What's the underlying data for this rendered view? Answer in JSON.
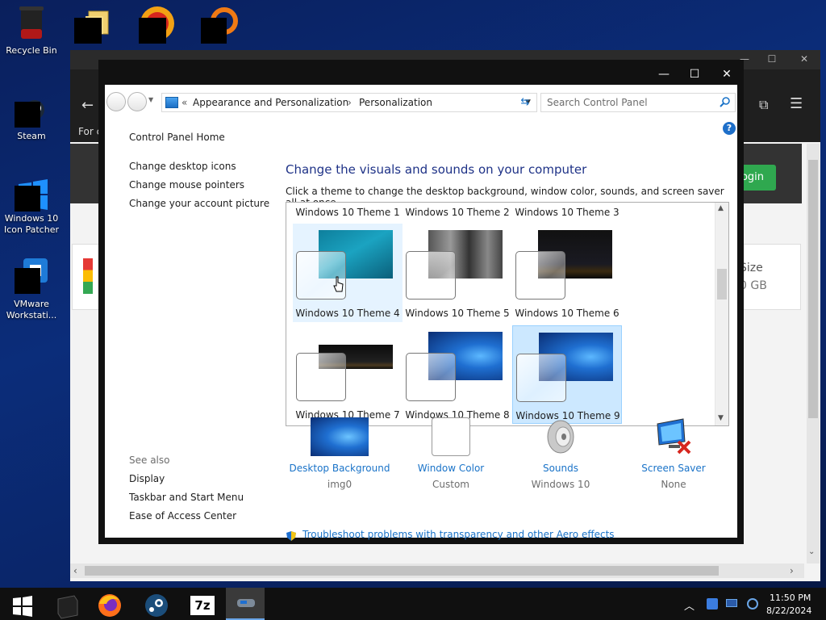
{
  "desktop": {
    "icons": [
      {
        "label": "Recycle Bin"
      },
      {
        "label": "Steam"
      },
      {
        "label": "Windows 10 Icon Patcher"
      },
      {
        "label": "VMware Workstati..."
      }
    ]
  },
  "background_window": {
    "partial_text_1": "For c",
    "login_button": "ogin",
    "size_label": "Size",
    "size_value": "0 GB"
  },
  "control_panel": {
    "address": {
      "prefix": "«",
      "crumbs": [
        "Appearance and Personalization",
        "Personalization"
      ],
      "separator": "›"
    },
    "search_placeholder": "Search Control Panel",
    "sidebar": {
      "home": "Control Panel Home",
      "links": [
        "Change desktop icons",
        "Change mouse pointers",
        "Change your account picture"
      ],
      "see_also_title": "See also",
      "see_also": [
        "Display",
        "Taskbar and Start Menu",
        "Ease of Access Center"
      ]
    },
    "title": "Change the visuals and sounds on your computer",
    "subtitle": "Click a theme to change the desktop background, window color, sounds, and screen saver all at once.",
    "themes": [
      {
        "label": "Windows 10 Theme 1"
      },
      {
        "label": "Windows 10 Theme 2"
      },
      {
        "label": "Windows 10 Theme 3"
      },
      {
        "label": "Windows 10 Theme 4"
      },
      {
        "label": "Windows 10 Theme 5"
      },
      {
        "label": "Windows 10 Theme 6"
      },
      {
        "label": "Windows 10 Theme 7"
      },
      {
        "label": "Windows 10 Theme 8"
      },
      {
        "label": "Windows 10 Theme 9"
      }
    ],
    "selected_theme": "Windows 10 Theme 9",
    "hovered_theme": "Windows 10 Theme 4",
    "bottom": [
      {
        "link": "Desktop Background",
        "value": "img0"
      },
      {
        "link": "Window Color",
        "value": "Custom"
      },
      {
        "link": "Sounds",
        "value": "Windows 10"
      },
      {
        "link": "Screen Saver",
        "value": "None"
      }
    ],
    "troubleshoot": "Troubleshoot problems with transparency and other Aero effects"
  },
  "taskbar": {
    "time": "11:50 PM",
    "date": "8/22/2024",
    "apps": [
      "start-icon",
      "terminal-icon",
      "firefox-icon",
      "steam-icon",
      "7zip-icon",
      "vmware-icon"
    ],
    "seven_zip_label": "7z"
  },
  "colors": {
    "accent_link": "#1a73c8",
    "title_blue": "#1e3287",
    "selected_tile": "#cce8ff",
    "login_green": "#2fa84f"
  }
}
